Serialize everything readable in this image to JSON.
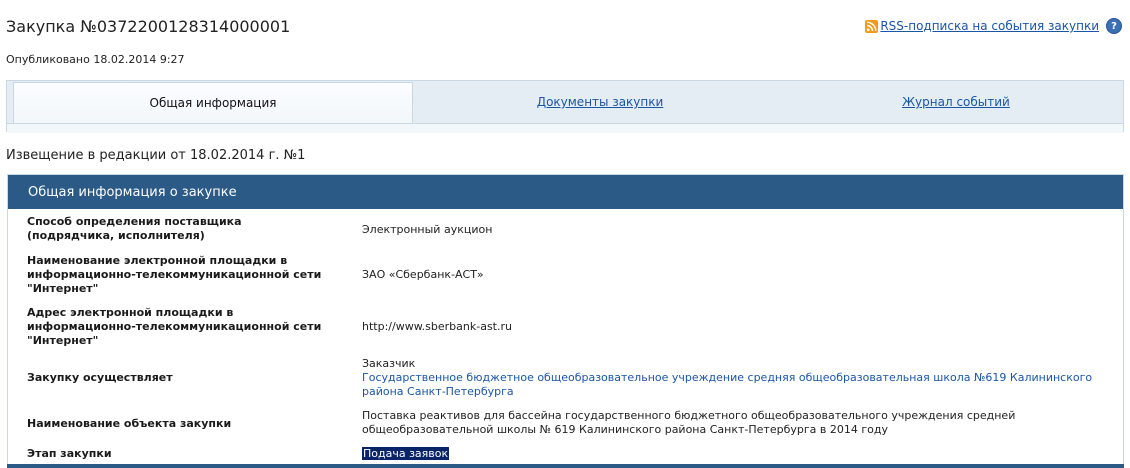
{
  "header": {
    "title": "Закупка №0372200128314000001",
    "published": "Опубликовано 18.02.2014 9:27",
    "rss_label": "RSS-подписка на события закупки"
  },
  "tabs": [
    {
      "label": "Общая информация",
      "active": true
    },
    {
      "label": "Документы закупки",
      "active": false
    },
    {
      "label": "Журнал событий",
      "active": false
    }
  ],
  "notice": "Извещение в редакции от 18.02.2014 г. №1",
  "section": {
    "title": "Общая информация о закупке",
    "rows": [
      {
        "label": "Способ определения поставщика (подрядчика, исполнителя)",
        "value": "Электронный аукцион"
      },
      {
        "label": "Наименование электронной площадки в информационно-телекоммуникационной сети \"Интернет\"",
        "value": "ЗАО «Сбербанк-АСТ»"
      },
      {
        "label": "Адрес электронной площадки в информационно-телекоммуникационной сети \"Интернет\"",
        "value": "http://www.sberbank-ast.ru"
      },
      {
        "label": "Закупку осуществляет",
        "value_prefix": "Заказчик",
        "value": "Государственное бюджетное общеобразовательное учреждение средняя общеобразовательная школа №619 Калининского района Санкт-Петербурга"
      },
      {
        "label": "Наименование объекта закупки",
        "value": "Поставка реактивов для бассейна государственного бюджетного общеобразовательного учреждения средней общеобразовательной школы № 619 Калининского района Санкт-Петербурга в 2014 году"
      },
      {
        "label": "Этап закупки",
        "value": "Подача заявок"
      }
    ]
  },
  "colors": {
    "header_bar": "#2c5a86",
    "link": "#1a56a8",
    "tab_bg": "#e4edf3",
    "rss": "#f39a1c"
  },
  "icons": [
    "rss-icon",
    "help-icon"
  ]
}
